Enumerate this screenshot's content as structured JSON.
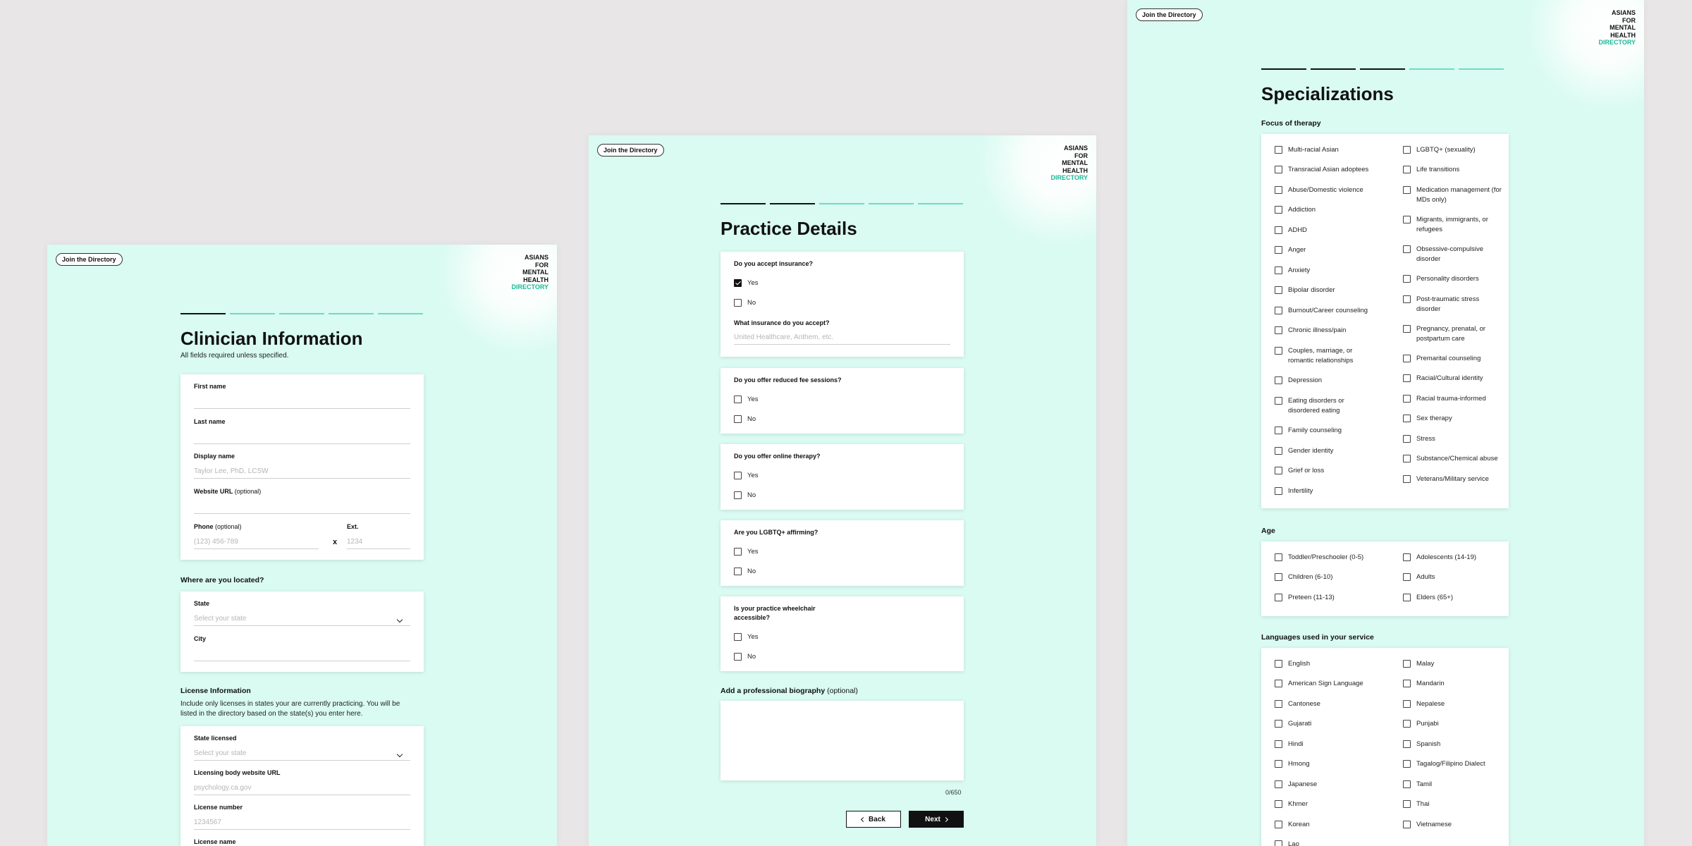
{
  "common": {
    "join_label": "Join the Directory",
    "logo_lines": [
      "ASIANS",
      "FOR",
      "MENTAL",
      "HEALTH"
    ],
    "logo_accent": "DIRECTORY",
    "accent_color": "#1cb796",
    "panel_bg": "#d9fbf1"
  },
  "clinician": {
    "title": "Clinician Information",
    "subtitle": "All fields required unless specified.",
    "progress_completed": 1,
    "progress_total": 5,
    "first_name_label": "First name",
    "last_name_label": "Last name",
    "display_name_label": "Display name",
    "display_name_placeholder": "Taylor Lee, PhD, LCSW",
    "website_label": "Website URL",
    "website_optional": "(optional)",
    "phone_label": "Phone",
    "phone_optional": "(optional)",
    "phone_placeholder": "(123) 456-789",
    "ext_separator": "x",
    "ext_label": "Ext.",
    "ext_placeholder": "1234",
    "location_heading": "Where are you located?",
    "state_label": "State",
    "state_placeholder": "Select your state",
    "city_label": "City",
    "license_heading": "License Information",
    "license_text": "Include only licenses in states your are currently practicing. You will be listed in the directory based on the state(s) you enter here.",
    "state_licensed_label": "State licensed",
    "state_licensed_placeholder": "Select your state",
    "licensing_url_label": "Licensing body website URL",
    "licensing_url_placeholder": "psychology.ca.gov",
    "license_number_label": "License number",
    "license_number_placeholder": "1234567",
    "license_name_label": "License name"
  },
  "practice": {
    "title": "Practice Details",
    "progress_completed": 2,
    "progress_total": 5,
    "insurance_q": "Do you accept insurance?",
    "insurance_yes": "Yes",
    "insurance_no": "No",
    "insurance_yes_checked": true,
    "which_insurance_q": "What insurance do you accept?",
    "which_insurance_placeholder": "United Healthcare, Anthem, etc.",
    "reduced_fee_q": "Do you offer reduced fee sessions?",
    "online_q": "Do you offer online therapy?",
    "lgbtq_q": "Are you LGBTQ+ affirming?",
    "wheelchair_q": "Is your practice wheelchair accessible?",
    "yes": "Yes",
    "no": "No",
    "bio_label": "Add a professional biography",
    "bio_optional": "(optional)",
    "counter": "0/650",
    "back_label": "Back",
    "next_label": "Next"
  },
  "specializations": {
    "title": "Specializations",
    "progress_completed": 3,
    "progress_total": 5,
    "focus_heading": "Focus of therapy",
    "focus_left": [
      "Multi-racial Asian",
      "Transracial Asian adoptees",
      "Abuse/Domestic violence",
      "Addiction",
      "ADHD",
      "Anger",
      "Anxiety",
      "Bipolar disorder",
      "Burnout/Career counseling",
      "Chronic illness/pain",
      "Couples, marriage, or romantic relationships",
      "Depression",
      "Eating disorders or disordered eating",
      "Family counseling",
      "Gender identity",
      "Grief or loss",
      "Infertility"
    ],
    "focus_right": [
      "LGBTQ+ (sexuality)",
      "Life transitions",
      "Medication management (for MDs only)",
      "Migrants, immigrants, or refugees",
      "Obsessive-compulsive disorder",
      "Personality disorders",
      "Post-traumatic stress disorder",
      "Pregnancy, prenatal, or postpartum care",
      "Premarital counseling",
      "Racial/Cultural identity",
      "Racial trauma-informed",
      "Sex therapy",
      "Stress",
      "Substance/Chemical abuse",
      "Veterans/Military service"
    ],
    "age_heading": "Age",
    "age_left": [
      "Toddler/Preschooler (0-5)",
      "Children (6-10)",
      "Preteen (11-13)"
    ],
    "age_right": [
      "Adolescents (14-19)",
      "Adults",
      "Elders (65+)"
    ],
    "languages_heading": "Languages used in your service",
    "lang_left": [
      "English",
      "American Sign Language",
      "Cantonese",
      "Gujarati",
      "Hindi",
      "Hmong",
      "Japanese",
      "Khmer",
      "Korean",
      "Lao"
    ],
    "lang_right": [
      "Malay",
      "Mandarin",
      "Nepalese",
      "Punjabi",
      "Spanish",
      "Tagalog/Filipino Dialect",
      "Tamil",
      "Thai",
      "Vietnamese"
    ]
  }
}
